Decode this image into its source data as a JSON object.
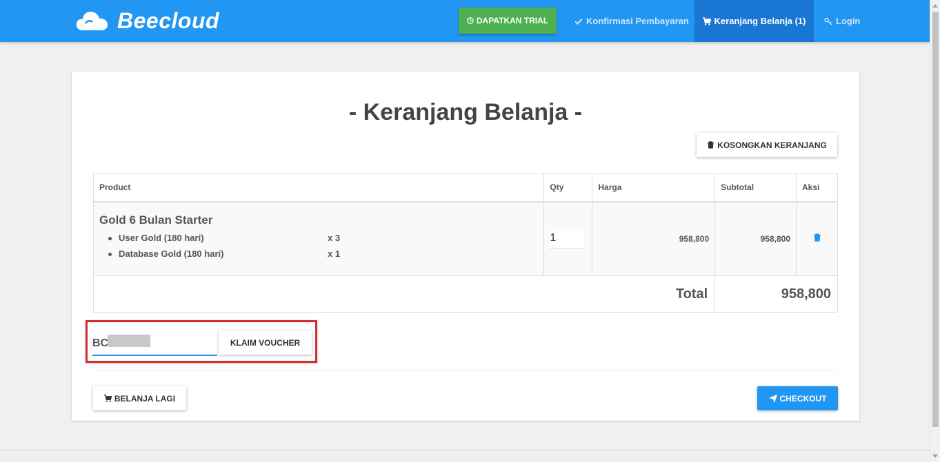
{
  "navbar": {
    "brand_name": "Beecloud",
    "trial_label": "DAPATKAN TRIAL",
    "confirm_label": "Konfirmasi Pembayaran",
    "cart_label": "Keranjang Belanja (1)",
    "login_label": "Login",
    "bg_color": "#2196f3",
    "active_color": "#1976d2",
    "trial_color": "#4caf50"
  },
  "page": {
    "title": "- Keranjang Belanja -",
    "empty_cart_label": "KOSONGKAN KERANJANG"
  },
  "table": {
    "headers": [
      "Product",
      "Qty",
      "Harga",
      "Subtotal",
      "Aksi"
    ],
    "items": [
      {
        "name": "Gold 6 Bulan Starter",
        "components": [
          {
            "name": "User Gold (180 hari)",
            "qty": "x 3"
          },
          {
            "name": "Database Gold (180 hari)",
            "qty": "x 1"
          }
        ],
        "qty": "1",
        "price": "958,800",
        "subtotal": "958,800",
        "action_icon": "trash-icon"
      }
    ],
    "total_label": "Total",
    "total_value": "958,800"
  },
  "voucher": {
    "value": "BC",
    "claim_label": "KLAIM VOUCHER",
    "highlight_color": "#d32f2f"
  },
  "actions": {
    "shop_again_label": "BELANJA LAGI",
    "checkout_label": "CHECKOUT",
    "checkout_color": "#2196f3"
  }
}
